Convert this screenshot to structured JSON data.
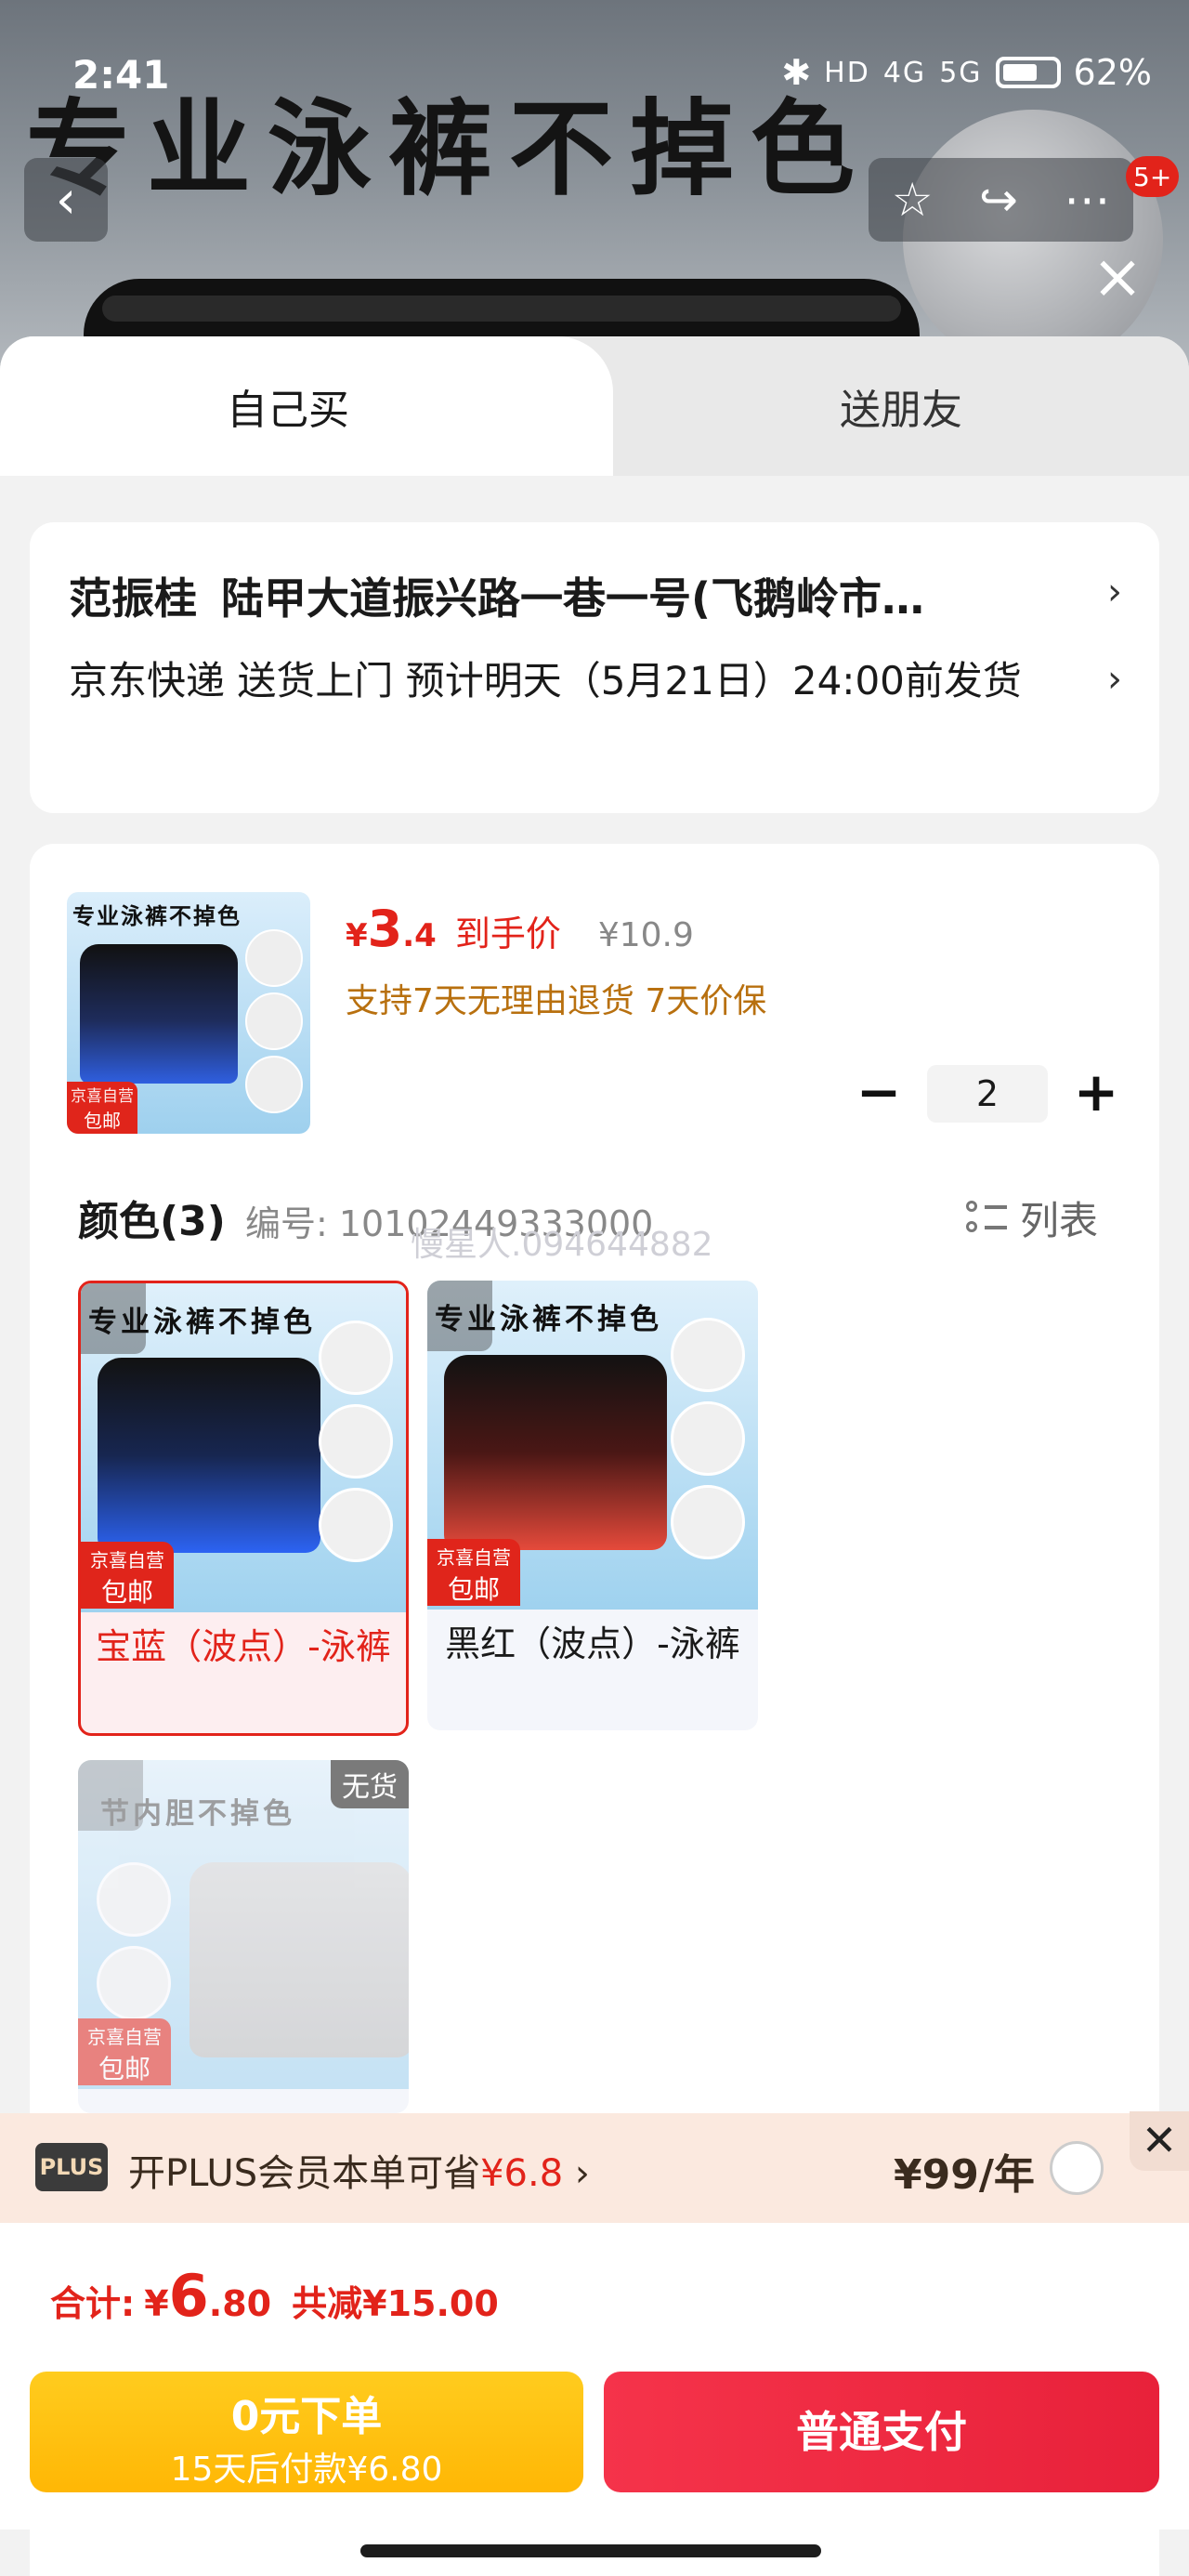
{
  "status": {
    "time": "2:41",
    "net1": "HD",
    "net2": "4G",
    "net3": "5G",
    "battery": "62%"
  },
  "hero": {
    "slogan": "专业泳裤不掉色",
    "cart_badge": "5+"
  },
  "tabs": {
    "self": "自己买",
    "friend": "送朋友"
  },
  "address": {
    "name": "范振桂",
    "detail": "陆甲大道振兴路一巷一号(飞鹅岭市…",
    "shipping": "京东快递 送货上门 预计明天（5月21日）24:00前发货"
  },
  "product": {
    "thumb_slogan": "专业泳裤不掉色",
    "jd_badge_top": "京喜自营",
    "jd_badge_bottom": "包邮",
    "price_symbol": "¥",
    "price_int": "3",
    "price_dec": ".4",
    "arrive_label": "到手价",
    "original_price": "¥10.9",
    "promise": "支持7天无理由退货 7天价保",
    "quantity": "2",
    "minus": "−",
    "plus": "+"
  },
  "spec": {
    "heading": "颜色(3)",
    "code": "编号: 10102449333000",
    "watermark": "慢星人.094644882",
    "list_toggle": "列表"
  },
  "swatches": [
    {
      "top": "专业泳裤不掉色",
      "label": "宝蓝（波点）-泳裤",
      "selected": true
    },
    {
      "top": "专业泳裤不掉色",
      "label": "黑红（波点）-泳裤",
      "selected": false
    },
    {
      "top": "节内胆不掉色",
      "label": "",
      "sold_out": "无货"
    }
  ],
  "plus": {
    "tag": "PLUS",
    "text_prefix": "开PLUS会员本单可省",
    "save": "¥6.8",
    "chevron": "›",
    "price": "¥99/年",
    "close": "✕"
  },
  "total": {
    "label": "合计:",
    "symbol": "¥",
    "int": "6",
    "dec": ".80",
    "cut": "共减¥15.00"
  },
  "buttons": {
    "later_line1": "0元下单",
    "later_line2": "15天后付款¥6.80",
    "pay": "普通支付"
  },
  "colors": {
    "accent": "#e2231a",
    "promise": "#b8700f",
    "later": "#ffbf0f",
    "pay": "#ef2a42"
  }
}
